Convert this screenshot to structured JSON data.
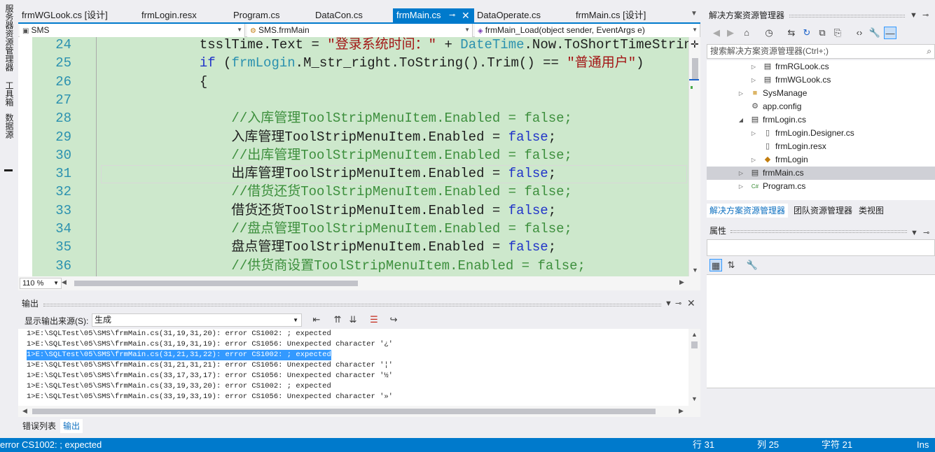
{
  "left_strip": {
    "tabs": [
      "服务器资源管理器",
      "工具箱",
      "数据源"
    ]
  },
  "doc_tabs": [
    {
      "label": "frmWGLook.cs [设计]"
    },
    {
      "label": "frmLogin.resx"
    },
    {
      "label": "Program.cs"
    },
    {
      "label": "DataCon.cs"
    },
    {
      "label": "frmMain.cs",
      "active": true
    },
    {
      "label": "DataOperate.cs"
    },
    {
      "label": "frmMain.cs [设计]"
    }
  ],
  "navbar": {
    "project": "SMS",
    "class": "SMS.frmMain",
    "member": "frmMain_Load(object sender, EventArgs e)"
  },
  "editor": {
    "lines": [
      {
        "num": "24",
        "parts": [
          [
            "",
            "            tsslTime.Text = "
          ],
          [
            "str",
            "\"登录系统时间：\""
          ],
          [
            "",
            " + "
          ],
          [
            "ty",
            "DateTime"
          ],
          [
            "",
            ".Now.ToShortTimeStrin"
          ]
        ]
      },
      {
        "num": "25",
        "parts": [
          [
            "kw",
            "            if"
          ],
          [
            "",
            " ("
          ],
          [
            "ty",
            "frmLogin"
          ],
          [
            "",
            ".M_str_right.ToString().Trim() == "
          ],
          [
            "str",
            "\"普通用户\""
          ],
          [
            "",
            ")"
          ]
        ]
      },
      {
        "num": "26",
        "parts": [
          [
            "",
            "            {"
          ]
        ]
      },
      {
        "num": "27",
        "parts": [
          [
            "",
            ""
          ]
        ]
      },
      {
        "num": "28",
        "parts": [
          [
            "cm",
            "                //入库管理ToolStripMenuItem.Enabled = false;"
          ]
        ]
      },
      {
        "num": "29",
        "parts": [
          [
            "",
            "                入库管理ToolStripMenuItem.Enabled = "
          ],
          [
            "kw",
            "false"
          ],
          [
            "",
            ";"
          ]
        ]
      },
      {
        "num": "30",
        "parts": [
          [
            "cm",
            "                //出库管理ToolStripMenuItem.Enabled = false;"
          ]
        ]
      },
      {
        "num": "31",
        "parts": [
          [
            "",
            "                出库管理ToolStripMenuItem.Enabled = "
          ],
          [
            "kw",
            "false"
          ],
          [
            "",
            ";"
          ]
        ]
      },
      {
        "num": "32",
        "parts": [
          [
            "cm",
            "                //借货还货ToolStripMenuItem.Enabled = false;"
          ]
        ]
      },
      {
        "num": "33",
        "parts": [
          [
            "",
            "                借货还货ToolStripMenuItem.Enabled = "
          ],
          [
            "kw",
            "false"
          ],
          [
            "",
            ";"
          ]
        ]
      },
      {
        "num": "34",
        "parts": [
          [
            "cm",
            "                //盘点管理ToolStripMenuItem.Enabled = false;"
          ]
        ]
      },
      {
        "num": "35",
        "parts": [
          [
            "",
            "                盘点管理ToolStripMenuItem.Enabled = "
          ],
          [
            "kw",
            "false"
          ],
          [
            "",
            ";"
          ]
        ]
      },
      {
        "num": "36",
        "parts": [
          [
            "cm",
            "                //供货商设置ToolStripMenuItem.Enabled = false;"
          ]
        ]
      }
    ],
    "zoom": "110 %"
  },
  "output": {
    "title": "输出",
    "source_label": "显示输出来源(S):",
    "source_value": "生成",
    "lines": [
      "1>E:\\SQLTest\\05\\SMS\\frmMain.cs(31,19,31,20): error CS1002: ; expected",
      "1>E:\\SQLTest\\05\\SMS\\frmMain.cs(31,19,31,19): error CS1056: Unexpected character '¿'",
      "1>E:\\SQLTest\\05\\SMS\\frmMain.cs(31,21,31,22): error CS1002: ; expected",
      "1>E:\\SQLTest\\05\\SMS\\frmMain.cs(31,21,31,21): error CS1056: Unexpected character '¦'",
      "1>E:\\SQLTest\\05\\SMS\\frmMain.cs(33,17,33,17): error CS1056: Unexpected character '½'",
      "1>E:\\SQLTest\\05\\SMS\\frmMain.cs(33,19,33,20): error CS1002: ; expected",
      "1>E:\\SQLTest\\05\\SMS\\frmMain.cs(33,19,33,19): error CS1056: Unexpected character '»'"
    ],
    "selected_index": 2
  },
  "bottom_tabs": {
    "error_list": "错误列表",
    "output": "输出"
  },
  "statusbar": {
    "message": "error CS1002: ; expected",
    "line": "行 31",
    "col": "列 25",
    "char": "字符 21",
    "mode": "Ins"
  },
  "solution_explorer": {
    "title": "解决方案资源管理器",
    "search_placeholder": "搜索解决方案资源管理器(Ctrl+;)",
    "items": [
      {
        "label": "frmRGLook.cs",
        "indent": 2,
        "arrow": "▷",
        "icon": "form-icon"
      },
      {
        "label": "frmWGLook.cs",
        "indent": 2,
        "arrow": "▷",
        "icon": "form-icon"
      },
      {
        "label": "SysManage",
        "indent": 1,
        "arrow": "▷",
        "icon": "folder-icon"
      },
      {
        "label": "app.config",
        "indent": 1,
        "arrow": "",
        "icon": "config-icon"
      },
      {
        "label": "frmLogin.cs",
        "indent": 1,
        "arrow": "◢",
        "icon": "form-icon"
      },
      {
        "label": "frmLogin.Designer.cs",
        "indent": 2,
        "arrow": "▷",
        "icon": "file-icon"
      },
      {
        "label": "frmLogin.resx",
        "indent": 2,
        "arrow": "",
        "icon": "file-icon"
      },
      {
        "label": "frmLogin",
        "indent": 2,
        "arrow": "▷",
        "icon": "class-icon"
      },
      {
        "label": "frmMain.cs",
        "indent": 1,
        "arrow": "▷",
        "icon": "form-icon",
        "selected": true
      },
      {
        "label": "Program.cs",
        "indent": 1,
        "arrow": "▷",
        "icon": "csharp-icon"
      }
    ],
    "tabs": [
      "解决方案资源管理器",
      "团队资源管理器",
      "类视图"
    ]
  },
  "properties": {
    "title": "属性"
  },
  "colors": {
    "accent": "#007acc",
    "editor_bg": "#cde8cc",
    "selection": "#3399ff"
  }
}
